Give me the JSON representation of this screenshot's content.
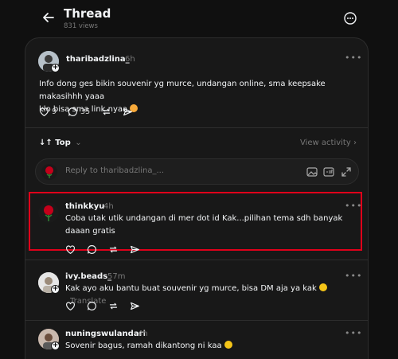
{
  "header": {
    "title": "Thread",
    "views": "831 views"
  },
  "post": {
    "username": "tharibadzlina_",
    "time": "6h",
    "text_line1": "Info dong ges bikin souvenir yg murce, undangan online, sma keepsake makasihhh yaaa",
    "text_line2": "klo bisa sma link nyaa",
    "likes": "9",
    "comments": "35"
  },
  "sort": {
    "label": "Top",
    "view_activity": "View activity"
  },
  "reply": {
    "placeholder": "Reply to tharibadzlina_..."
  },
  "replies": [
    {
      "username": "thinkkyu",
      "time": "4h",
      "line1": "Coba utak utik undangan di mer dot id Kak...pilihan tema sdh banyak",
      "line2": "daaan gratis"
    },
    {
      "username": "ivy.beads_",
      "time": "57m",
      "line1": "Kak ayo aku bantu buat souvenir yg murce, bisa DM aja ya kak",
      "translate": "Translate"
    },
    {
      "username": "nuningswulandari",
      "time": "4h",
      "line1": "Sovenir bagus, ramah dikantong ni kaa"
    }
  ],
  "colors": {
    "background": "#101010",
    "card": "#181818",
    "highlight": "#e0001a",
    "muted": "#777777"
  }
}
